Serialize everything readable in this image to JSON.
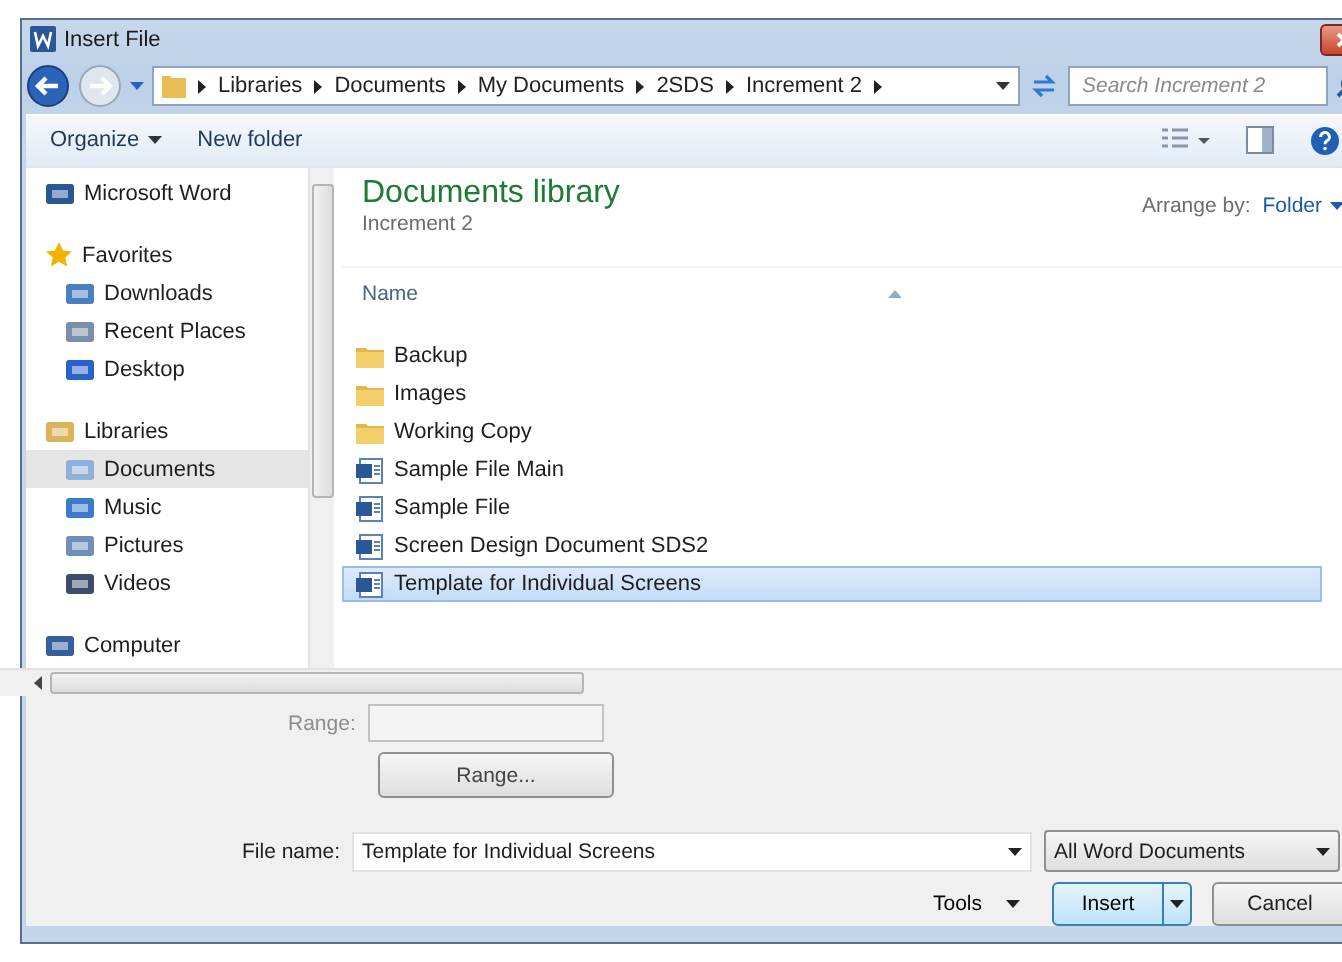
{
  "window": {
    "title": "Insert File"
  },
  "breadcrumb": [
    "Libraries",
    "Documents",
    "My Documents",
    "2SDS",
    "Increment 2"
  ],
  "search": {
    "placeholder": "Search Increment 2"
  },
  "toolbar": {
    "organize": "Organize",
    "new_folder": "New folder"
  },
  "sidebar": [
    {
      "label": "Microsoft Word",
      "selected": false
    },
    {
      "label": "Favorites",
      "selected": false,
      "children": [
        {
          "label": "Downloads",
          "selected": false
        },
        {
          "label": "Recent Places",
          "selected": false
        },
        {
          "label": "Desktop",
          "selected": false
        }
      ]
    },
    {
      "label": "Libraries",
      "selected": false,
      "children": [
        {
          "label": "Documents",
          "selected": true
        },
        {
          "label": "Music",
          "selected": false
        },
        {
          "label": "Pictures",
          "selected": false
        },
        {
          "label": "Videos",
          "selected": false
        }
      ]
    },
    {
      "label": "Computer",
      "selected": false
    }
  ],
  "library": {
    "title": "Documents library",
    "subtitle": "Increment 2",
    "arrange_label": "Arrange by:",
    "arrange_value": "Folder"
  },
  "column": "Name",
  "files": [
    {
      "name": "Backup",
      "kind": "folder",
      "selected": false
    },
    {
      "name": "Images",
      "kind": "folder",
      "selected": false
    },
    {
      "name": "Working Copy",
      "kind": "folder",
      "selected": false
    },
    {
      "name": "Sample File Main",
      "kind": "document",
      "selected": false
    },
    {
      "name": "Sample File",
      "kind": "document",
      "selected": false
    },
    {
      "name": "Screen Design Document SDS2",
      "kind": "document",
      "selected": false
    },
    {
      "name": "Template for Individual Screens",
      "kind": "document",
      "selected": true
    }
  ],
  "range": {
    "label": "Range:",
    "button": "Range...",
    "disabled": true
  },
  "file_name": {
    "label": "File name:",
    "value": "Template for Individual Screens"
  },
  "file_type": "All Word Documents",
  "buttons": {
    "tools": "Tools",
    "insert": "Insert",
    "cancel": "Cancel"
  }
}
